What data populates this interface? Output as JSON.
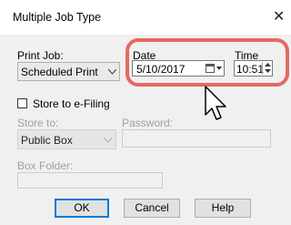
{
  "window": {
    "title": "Multiple Job Type"
  },
  "print_job": {
    "label": "Print Job:",
    "label_underline": "J",
    "value": "Scheduled Print"
  },
  "date": {
    "label": "Date",
    "value": "5/10/2017"
  },
  "time": {
    "label": "Time",
    "value": "10:51"
  },
  "store_efiling": {
    "label": "Store to e-Filing",
    "checked": false
  },
  "store_to": {
    "label": "Store to:",
    "value": "Public Box"
  },
  "password": {
    "label": "Password:",
    "value": ""
  },
  "box_folder": {
    "label": "Box Folder:",
    "value": ""
  },
  "buttons": {
    "ok": "OK",
    "cancel": "Cancel",
    "help": "Help"
  },
  "colors": {
    "highlight": "#e46a60",
    "default_button_border": "#0078d7"
  }
}
